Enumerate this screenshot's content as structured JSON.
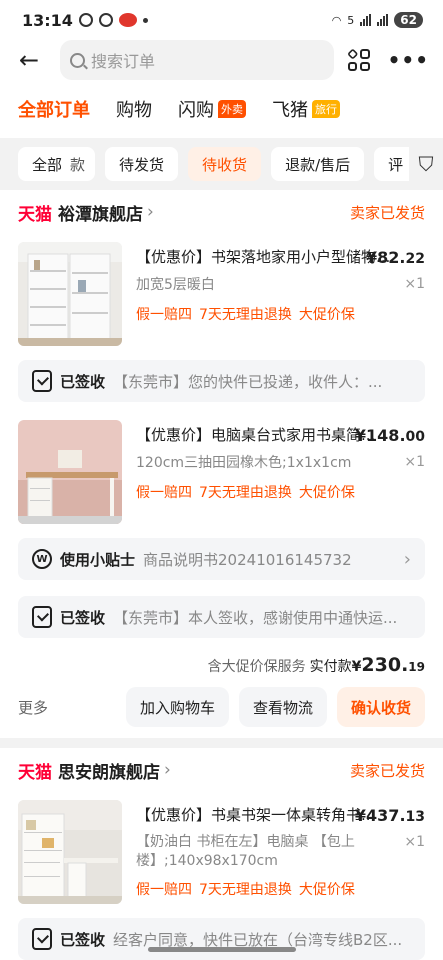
{
  "status_bar": {
    "time": "13:14",
    "network_badge": "5",
    "battery": "62",
    "icons": [
      "wechat-icon",
      "chrome-icon",
      "app-red-icon"
    ]
  },
  "top_bar": {
    "search_placeholder": "搜索订单"
  },
  "tabs": [
    {
      "label": "全部订单",
      "active": true,
      "badge": ""
    },
    {
      "label": "购物",
      "active": false,
      "badge": ""
    },
    {
      "label": "闪购",
      "active": false,
      "badge": "外卖",
      "badge_color": "#ff5000"
    },
    {
      "label": "飞猪",
      "active": false,
      "badge": "旅行",
      "badge_color": "#ffb000"
    }
  ],
  "chips": [
    {
      "label": "全部",
      "selected": false
    },
    {
      "label": "款",
      "selected": false
    },
    {
      "label": "待发货",
      "selected": false
    },
    {
      "label": "待收货",
      "selected": true
    },
    {
      "label": "退款/售后",
      "selected": false
    },
    {
      "label": "评",
      "selected": false
    }
  ],
  "orders": [
    {
      "brand": "天猫",
      "shop": "裕潭旗舰店",
      "status": "卖家已发货",
      "items": [
        {
          "title": "【优惠价】书架落地家用小户型储物...",
          "sku": "加宽5层暖白",
          "services": [
            "假一赔四",
            "7天无理由退换",
            "大促价保"
          ],
          "price_int": "¥82.",
          "price_dec": "22",
          "qty": "×1"
        }
      ],
      "logistics_1": {
        "label": "已签收",
        "text": "【东莞市】您的快件已投递，收件人：..."
      },
      "items2": [
        {
          "title": "【优惠价】电脑桌台式家用书桌简...",
          "sku": "120cm三抽田园橡木色;1x1x1cm",
          "services": [
            "假一赔四",
            "7天无理由退换",
            "大促价保"
          ],
          "price_int": "¥148.",
          "price_dec": "00",
          "qty": "×1"
        }
      ],
      "tip": {
        "label": "使用小贴士",
        "text": "商品说明书20241016145732"
      },
      "logistics_2": {
        "label": "已签收",
        "text": "【东莞市】本人签收，感谢使用中通快运..."
      },
      "total": {
        "note": "含大促价保服务",
        "label": "实付款",
        "currency": "¥",
        "amount": "230.",
        "cents": "19"
      },
      "actions": {
        "more": "更多",
        "buttons": [
          "加入购物车",
          "查看物流",
          "确认收货"
        ]
      }
    },
    {
      "brand": "天猫",
      "shop": "思安朗旗舰店",
      "status": "卖家已发货",
      "items": [
        {
          "title": "【优惠价】书桌书架一体桌转角书...",
          "sku": "【奶油白 书柜在左】电脑桌 【包上楼】;140x98x170cm",
          "services": [
            "假一赔四",
            "7天无理由退换",
            "大促价保"
          ],
          "price_int": "¥437.",
          "price_dec": "13",
          "qty": "×1"
        }
      ],
      "logistics_1": {
        "label": "已签收",
        "text": "经客户同意，快件已放在（台湾专线B2区..."
      }
    }
  ]
}
